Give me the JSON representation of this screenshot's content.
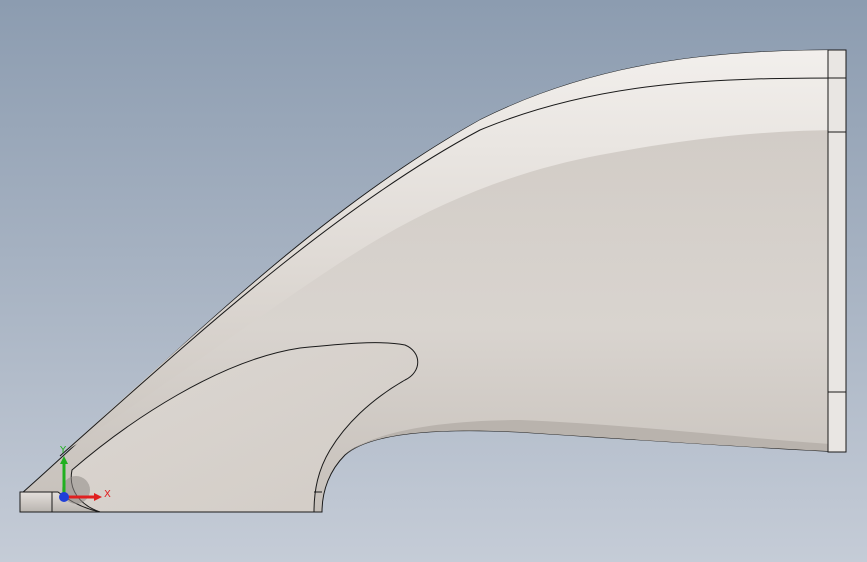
{
  "viewport": {
    "background_top": "#8c9cb0",
    "background_bottom": "#c5ccd7",
    "model_color": "#d8d3ce",
    "edge_color": "#1a1a1a"
  },
  "triad": {
    "x_label": "X",
    "y_label": "Y",
    "x_color": "#e02020",
    "y_color": "#20b020",
    "z_color": "#1f3fd8"
  }
}
